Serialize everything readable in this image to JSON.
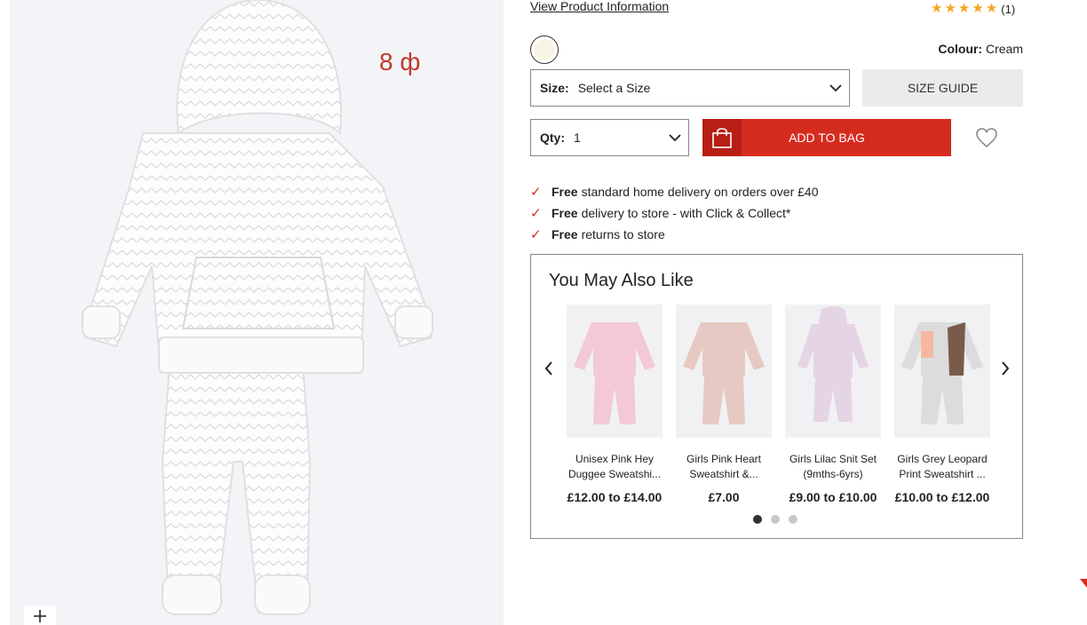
{
  "product": {
    "view_info_link": "View Product Information",
    "rating": {
      "stars": 5,
      "count_text": "(1)"
    },
    "colour": {
      "label": "Colour:",
      "value": "Cream",
      "swatch_hex": "#f8f5e6"
    },
    "size": {
      "label": "Size:",
      "value": "Select a Size"
    },
    "size_guide": "SIZE GUIDE",
    "qty": {
      "label": "Qty:",
      "value": "1"
    },
    "add_to_bag": "ADD TO BAG",
    "image_overlay_text": "8 ф",
    "benefits": [
      {
        "bold": "Free",
        "text": "standard home delivery on orders over £40"
      },
      {
        "bold": "Free",
        "text": "delivery to store - with Click & Collect*"
      },
      {
        "bold": "Free",
        "text": "returns to store"
      }
    ]
  },
  "recommendations": {
    "title": "You May Also Like",
    "items": [
      {
        "name": "Unisex Pink Hey Duggee Sweatshi...",
        "price": "£12.00 to £14.00",
        "color": "#f3c9d6"
      },
      {
        "name": "Girls Pink Heart Sweatshirt &...",
        "price": "£7.00",
        "color": "#e7c9c3"
      },
      {
        "name": "Girls Lilac Snit Set (9mths-6yrs)",
        "price": "£9.00 to £10.00",
        "color": "#e5d4e4"
      },
      {
        "name": "Girls Grey Leopard Print Sweatshirt ...",
        "price": "£10.00 to £12.00",
        "color": "#dcdcdc"
      }
    ],
    "pages": 3,
    "active_page": 1
  },
  "colors": {
    "accent": "#d52b1e",
    "accent_dark": "#b81e14",
    "star": "#f5a623"
  },
  "icons": [
    "plus-icon",
    "star-icon",
    "chevron-down-icon",
    "shopping-bag-icon",
    "heart-icon",
    "checkmark-icon",
    "chevron-left-icon",
    "chevron-right-icon"
  ]
}
